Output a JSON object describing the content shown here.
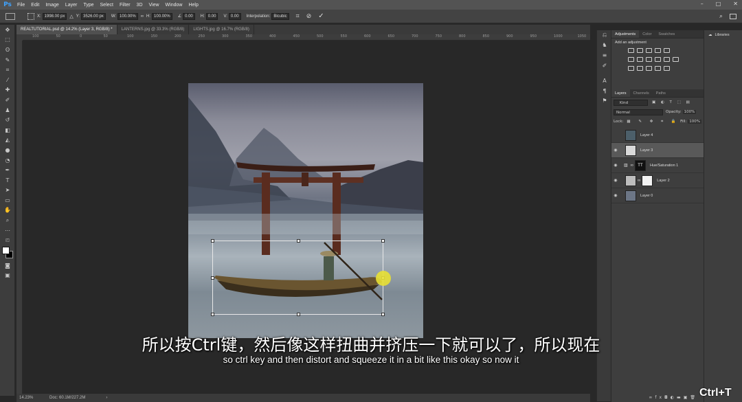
{
  "app": {
    "logo": "Ps",
    "accent": "#3fa3ff"
  },
  "menu": [
    "File",
    "Edit",
    "Image",
    "Layer",
    "Type",
    "Select",
    "Filter",
    "3D",
    "View",
    "Window",
    "Help"
  ],
  "window_controls": [
    "–",
    "□",
    "✕"
  ],
  "options_bar": {
    "x_label": "X:",
    "x_value": "1998.00 px",
    "y_label": "Y:",
    "y_value": "3526.00 px",
    "w_label": "W:",
    "w_value": "100.00%",
    "h_label": "H:",
    "h_value": "100.00%",
    "angle_value": "0.00",
    "hskew_label": "H:",
    "hskew_value": "0.00",
    "vskew_label": "V:",
    "vskew_value": "0.00",
    "interp_label": "Interpolation:",
    "interp_value": "Bicubic"
  },
  "tabs": [
    {
      "label": "REALTUTORIAL.psd @ 14.2% (Layer 3, RGB/8) *",
      "active": true
    },
    {
      "label": "LANTERNS.jpg @ 33.3% (RGB/8)",
      "active": false
    },
    {
      "label": "LIGHTS.jpg @ 16.7% (RGB/8)",
      "active": false
    }
  ],
  "ruler_ticks": [
    "100",
    "50",
    "0",
    "50",
    "100",
    "150",
    "200",
    "250",
    "300",
    "350",
    "400",
    "450",
    "500",
    "550",
    "600",
    "650",
    "700",
    "750",
    "800",
    "850",
    "900",
    "950",
    "1000",
    "1050"
  ],
  "status": {
    "zoom": "14.23%",
    "doc": "Doc: 60.1M/227.2M"
  },
  "adjustments": {
    "tabs": [
      "Adjustments",
      "Color",
      "Swatches"
    ],
    "title": "Add an adjustment"
  },
  "layers_panel": {
    "tabs": [
      "Layers",
      "Channels",
      "Paths"
    ],
    "kind": "Kind",
    "blend_mode": "Normal",
    "opacity_label": "Opacity:",
    "opacity_value": "100%",
    "lock_label": "Lock:",
    "fill_label": "Fill:",
    "fill_value": "100%",
    "layers": [
      {
        "name": "Layer 4",
        "visible": false,
        "selected": false
      },
      {
        "name": "Layer 3",
        "visible": true,
        "selected": true
      },
      {
        "name": "Hue/Saturation 1",
        "visible": true,
        "selected": false
      },
      {
        "name": "Layer 2",
        "visible": true,
        "selected": false
      },
      {
        "name": "Layer 0",
        "visible": true,
        "selected": false
      }
    ]
  },
  "libraries": {
    "label": "Libraries"
  },
  "subtitles": {
    "zh": "所以按Ctrl键，然后像这样扭曲并挤压一下就可以了，所以现在",
    "en": "so ctrl key and then distort and squeeze it in a bit like this okay so now it"
  },
  "shortcut_overlay": "Ctrl+T"
}
